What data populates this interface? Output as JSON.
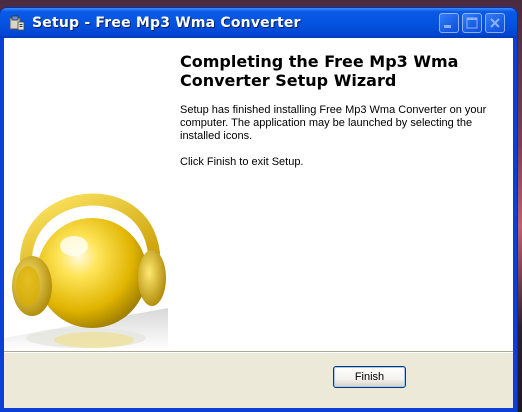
{
  "window": {
    "title": "Setup - Free Mp3 Wma Converter"
  },
  "icons": {
    "app": "setup-installer-icon",
    "minimize": "minimize-icon",
    "maximize": "maximize-icon",
    "close": "close-icon",
    "side_image": "headphones-ball-graphic"
  },
  "colors": {
    "titlebar": "#0453e0",
    "dialog_bg": "#ece9d8",
    "accent": "#f0c800"
  },
  "wizard": {
    "heading": "Completing the Free Mp3 Wma Converter Setup Wizard",
    "body": "Setup has finished installing Free Mp3 Wma Converter on your computer. The application may be launched by selecting the installed icons.",
    "exit_hint": "Click Finish to exit Setup."
  },
  "buttons": {
    "finish": "Finish"
  }
}
